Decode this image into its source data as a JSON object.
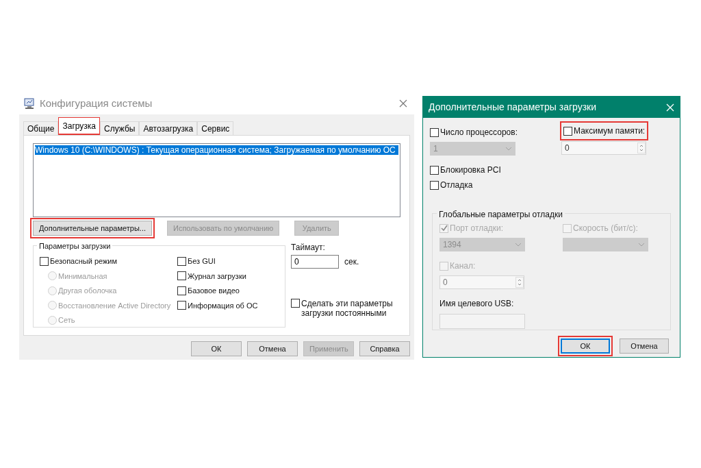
{
  "config_window": {
    "title": "Конфигурация системы",
    "tabs": [
      {
        "label": "Общие",
        "selected": false,
        "highlighted": false
      },
      {
        "label": "Загрузка",
        "selected": true,
        "highlighted": true
      },
      {
        "label": "Службы",
        "selected": false,
        "highlighted": false
      },
      {
        "label": "Автозагрузка",
        "selected": false,
        "highlighted": false
      },
      {
        "label": "Сервис",
        "selected": false,
        "highlighted": false
      }
    ],
    "boot_list": [
      {
        "label": "Windows 10 (C:\\WINDOWS) : Текущая операционная система; Загружаемая по умолчанию ОС",
        "selected": true
      }
    ],
    "list_buttons": [
      {
        "label": "Дополнительные параметры...",
        "disabled": false,
        "highlighted": true
      },
      {
        "label": "Использовать по умолчанию",
        "disabled": true,
        "highlighted": false
      },
      {
        "label": "Удалить",
        "disabled": true,
        "highlighted": false
      }
    ],
    "boot_options": {
      "title": "Параметры загрузки",
      "safe_mode": {
        "label": "Безопасный режим",
        "checked": false
      },
      "radios": [
        {
          "label": "Минимальная",
          "selected": false,
          "disabled": true
        },
        {
          "label": "Другая оболочка",
          "selected": false,
          "disabled": true
        },
        {
          "label": "Восстановление Active Directory",
          "selected": false,
          "disabled": true
        },
        {
          "label": "Сеть",
          "selected": false,
          "disabled": true
        }
      ],
      "checks": [
        {
          "label": "Без GUI",
          "checked": false
        },
        {
          "label": "Журнал загрузки",
          "checked": false
        },
        {
          "label": "Базовое видео",
          "checked": false
        },
        {
          "label": "Информация  об ОС",
          "checked": false
        }
      ]
    },
    "timeout": {
      "label": "Таймаут:",
      "value": "0",
      "unit": "сек."
    },
    "permanent": {
      "label": "Сделать эти параметры загрузки постоянными",
      "checked": false
    },
    "buttons": [
      {
        "label": "ОК",
        "disabled": false
      },
      {
        "label": "Отмена",
        "disabled": false
      },
      {
        "label": "Применить",
        "disabled": true
      },
      {
        "label": "Справка",
        "disabled": false
      }
    ]
  },
  "advanced_window": {
    "title": "Дополнительные параметры загрузки",
    "processors": {
      "label": "Число процессоров:",
      "checked": false,
      "value": "1",
      "disabled": true
    },
    "max_memory": {
      "label": "Максимум памяти:",
      "checked": false,
      "highlighted": true,
      "value": "0"
    },
    "options": [
      {
        "label": "Блокировка PCI",
        "checked": false
      },
      {
        "label": "Отладка",
        "checked": false
      }
    ],
    "debug_group": {
      "title": "Глобальные параметры отладки",
      "port": {
        "label": "Порт отладки:",
        "checked": true,
        "value": "1394"
      },
      "speed": {
        "label": "Скорость (бит/с):",
        "checked": false
      },
      "channel": {
        "label": "Канал:",
        "checked": false,
        "value": "0"
      },
      "usb": {
        "label": "Имя целевого USB:"
      }
    },
    "buttons": [
      {
        "label": "ОК",
        "highlighted": true
      },
      {
        "label": "Отмена",
        "highlighted": false
      }
    ]
  }
}
